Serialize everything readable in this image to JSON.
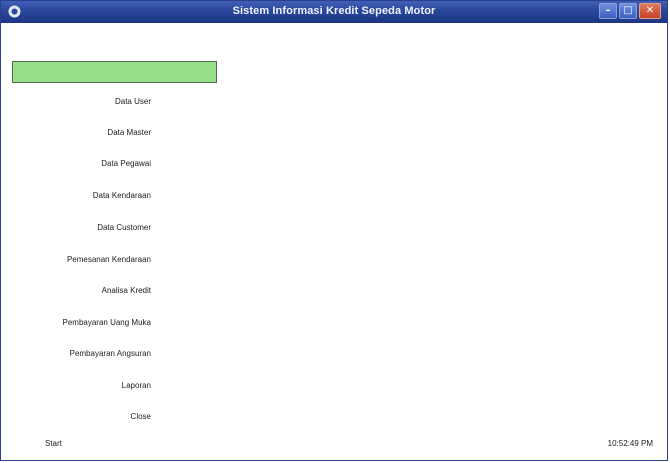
{
  "window": {
    "title": "Sistem Informasi Kredit Sepeda Motor",
    "buttons": {
      "minimize": "–",
      "maximize": "□",
      "close": "✕"
    }
  },
  "menu": {
    "items": [
      {
        "label": "Data User"
      },
      {
        "label": "Data Master"
      },
      {
        "label": "Data Pegawai"
      },
      {
        "label": "Data Kendaraan"
      },
      {
        "label": "Data Customer"
      },
      {
        "label": "Pemesanan Kendaraan"
      },
      {
        "label": "Analisa Kredit"
      },
      {
        "label": "Pembayaran Uang Muka"
      },
      {
        "label": "Pembayaran Angsuran"
      },
      {
        "label": "Laporan"
      },
      {
        "label": "Close"
      }
    ]
  },
  "status": {
    "left": "Start",
    "right": "10:52:49 PM"
  },
  "colors": {
    "titlebar": "#2a479b",
    "green_bar": "#98df89"
  }
}
